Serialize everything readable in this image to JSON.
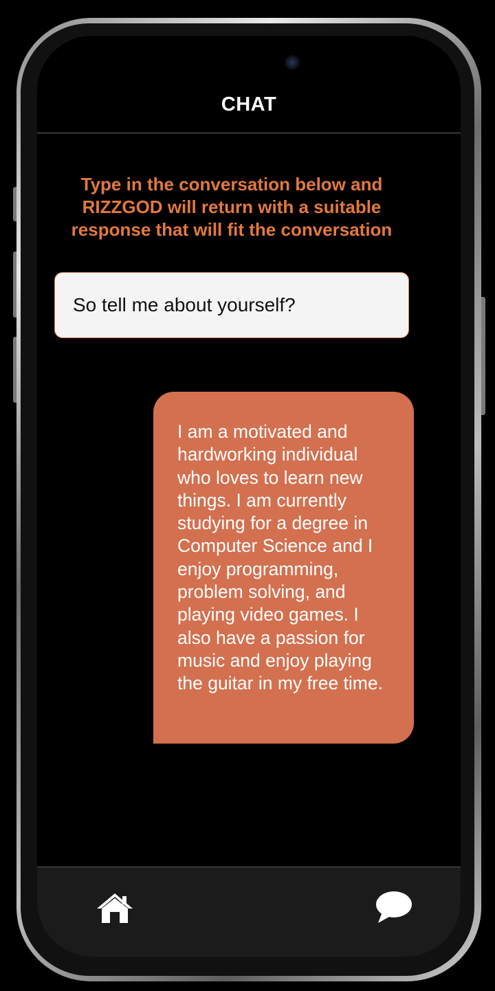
{
  "header": {
    "title": "CHAT"
  },
  "instructions": {
    "text": "Type in the conversation below and RIZZGOD will return with a suitable response that will fit the conversation"
  },
  "conversation_input": {
    "value": "So tell me about yourself?"
  },
  "response": {
    "text": "I am a motivated and hardworking individual who loves to learn new things. I am currently studying for a degree in Computer Science and I enjoy programming, problem solving, and playing video games. I also have a passion for music and enjoy playing the guitar in my free time."
  },
  "bottom_nav": {
    "items": [
      {
        "icon": "home-icon"
      },
      {
        "icon": "chat-bubble-icon"
      }
    ]
  },
  "colors": {
    "accent": "#e3793d",
    "bubble": "#d3704f",
    "background": "#000000",
    "nav_background": "#1b1b1b",
    "input_background": "#f4f4f4"
  }
}
